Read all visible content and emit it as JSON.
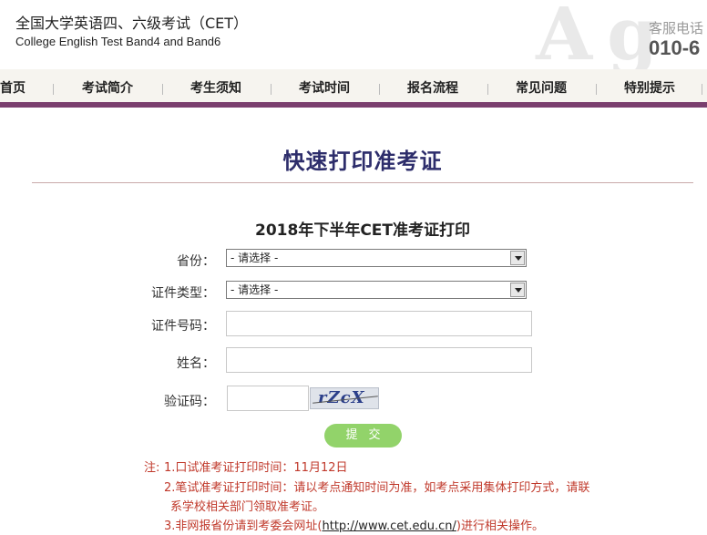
{
  "header": {
    "title": "全国大学英语四、六级考试（CET）",
    "subtitle": "College English Test Band4 and Band6",
    "hotline_label": "客服电话",
    "hotline_number": "010-6"
  },
  "nav": {
    "items": [
      "首页",
      "考试简介",
      "考生须知",
      "考试时间",
      "报名流程",
      "常见问题",
      "特别提示"
    ]
  },
  "page_title": "快速打印准考证",
  "form": {
    "title": "2018年下半年CET准考证打印",
    "province_label": "省份：",
    "province_value": "- 请选择 -",
    "id_type_label": "证件类型：",
    "id_type_value": "- 请选择 -",
    "id_number_label": "证件号码：",
    "name_label": "姓名：",
    "captcha_label": "验证码：",
    "captcha_text": "rZcX",
    "submit_label": "提交"
  },
  "notes": {
    "prefix": "注:",
    "line1": "1.口试准考证打印时间：11月12日",
    "line2a": "2.笔试准考证打印时间：请以考点通知时间为准，如考点采用集体打印方式，请联",
    "line2b": "系学校相关部门领取准考证。",
    "line3_pre": "3.非网报省份请到考委会网址(",
    "line3_link": "http://www.cet.edu.cn/",
    "line3_post": ")进行相关操作。"
  },
  "colors": {
    "nav_border": "#7a3f6e",
    "title_color": "#2d2d6b",
    "button_green": "#92d36a",
    "note_red": "#c0392b"
  }
}
